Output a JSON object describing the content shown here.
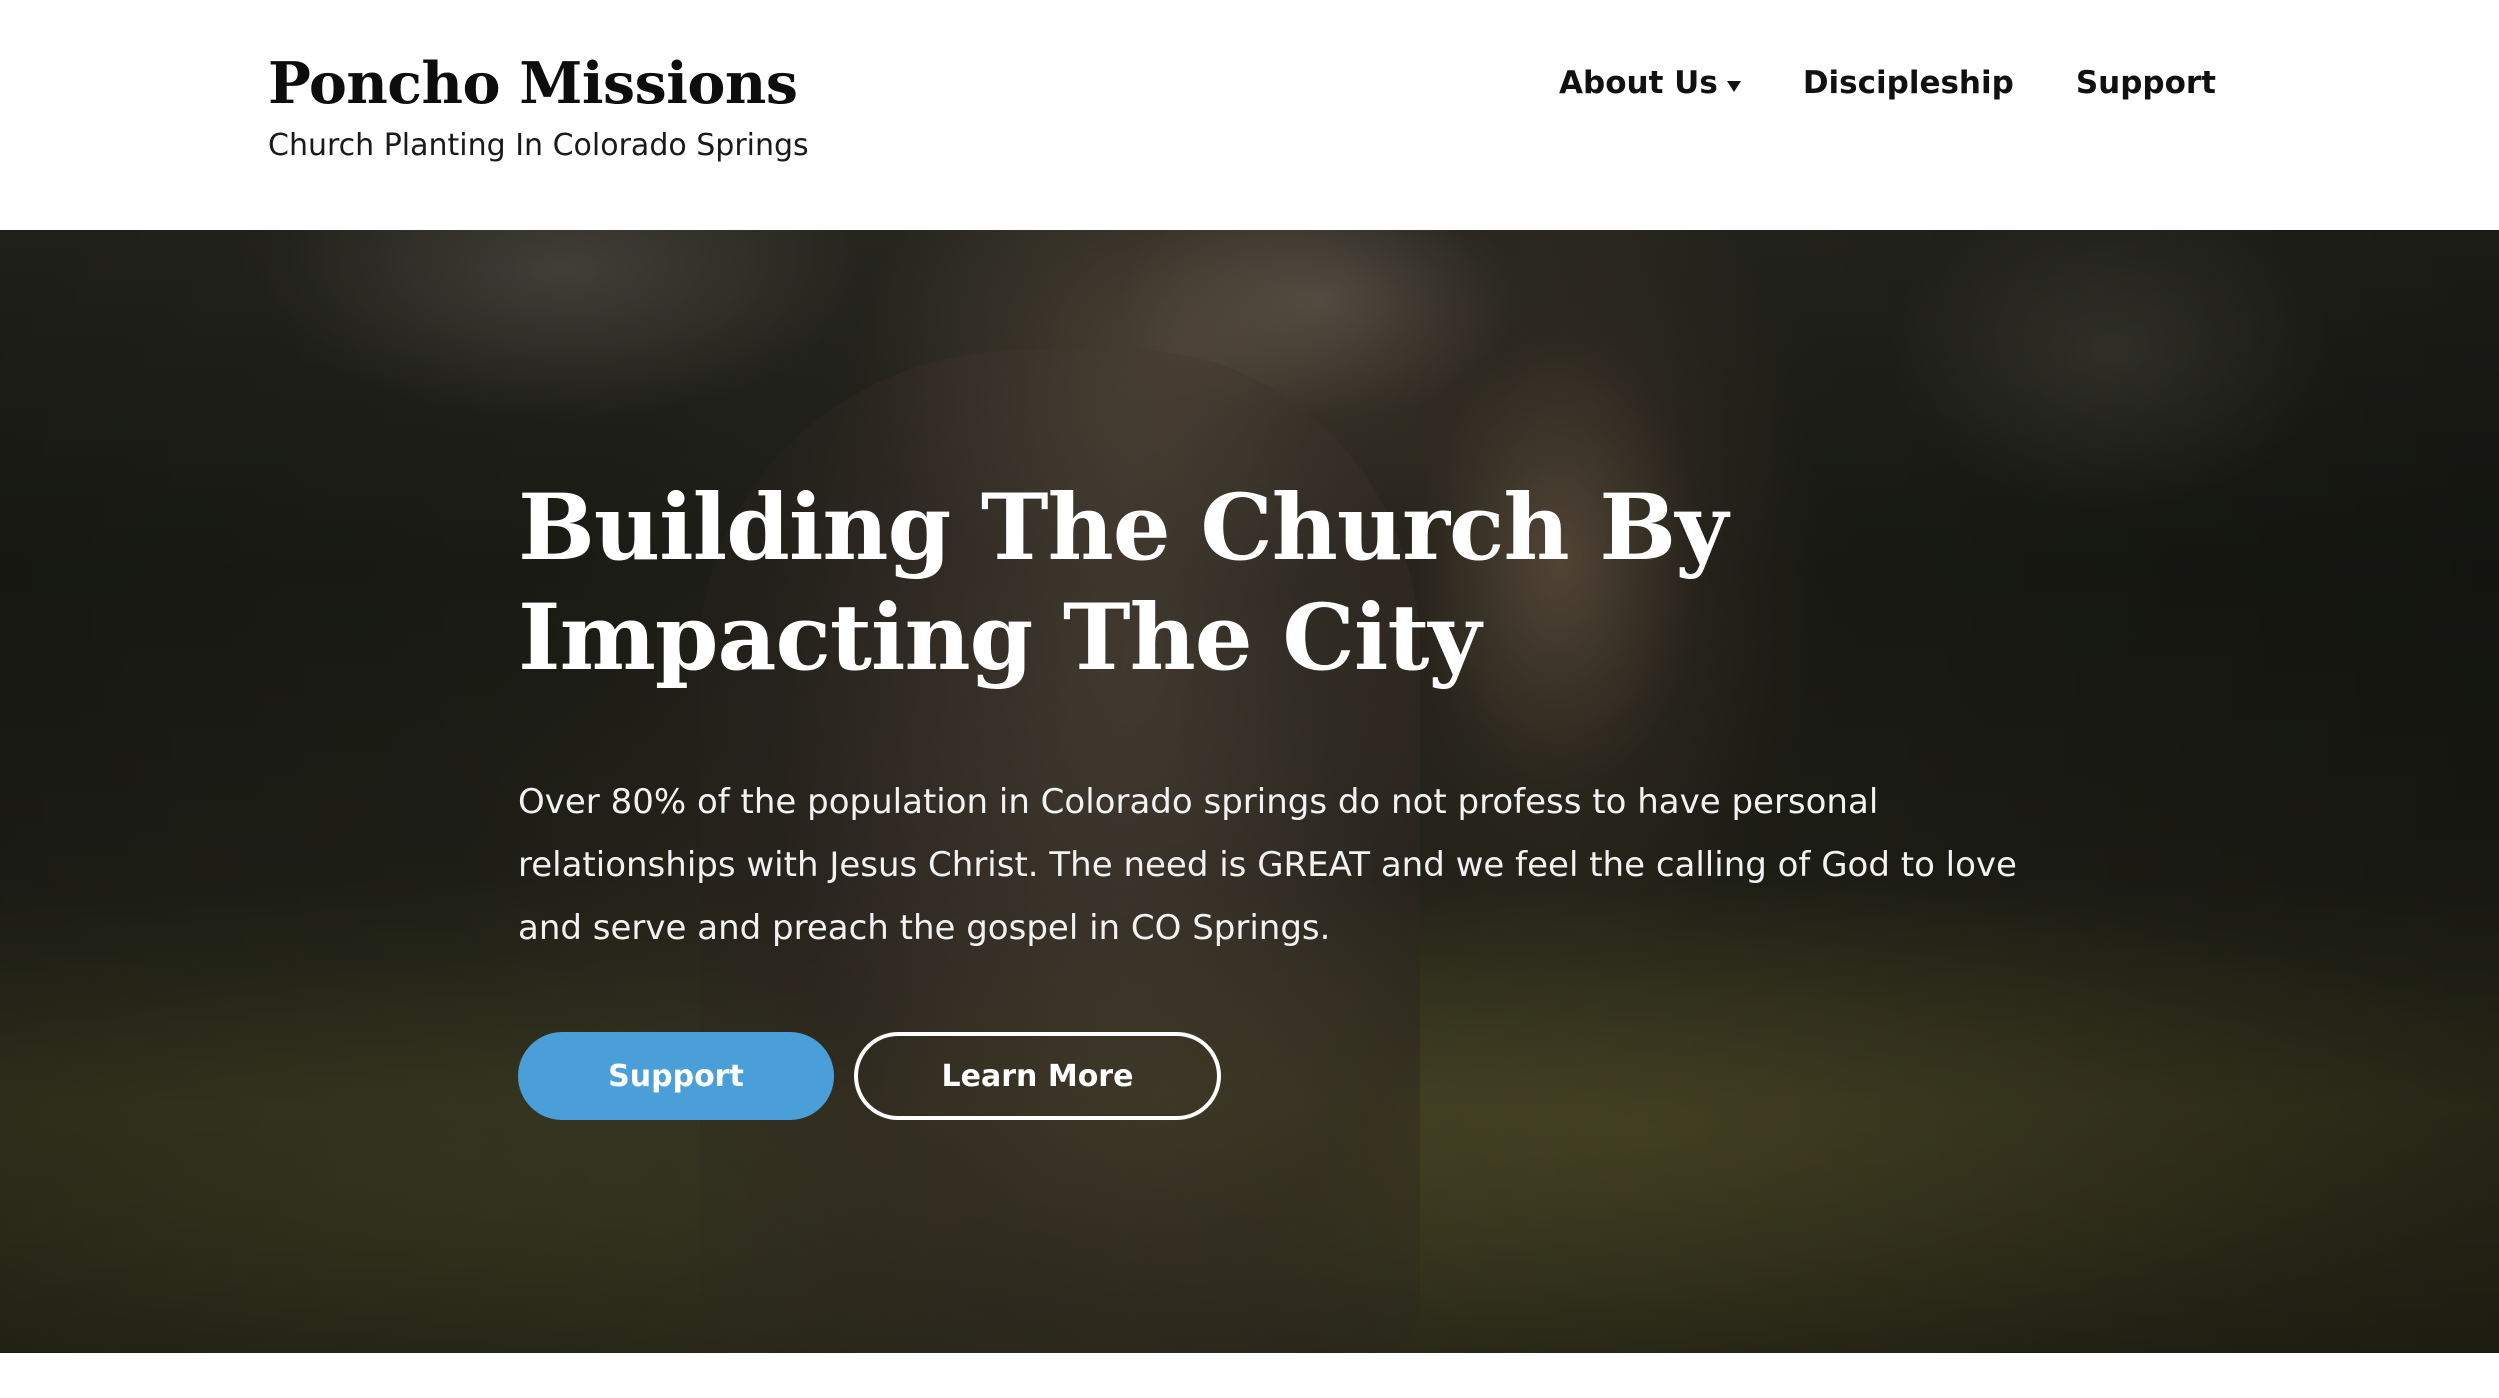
{
  "header": {
    "site_title": "Poncho Missions",
    "site_tagline": "Church Planting In Colorado Springs",
    "nav": [
      {
        "label": "About Us",
        "has_dropdown": true
      },
      {
        "label": "Discipleship",
        "has_dropdown": false
      },
      {
        "label": "Support",
        "has_dropdown": false
      }
    ]
  },
  "hero": {
    "heading": "Building The Church By Impacting The City",
    "text": "Over 80% of the population in Colorado springs do not profess to have personal relationships with Jesus Christ. The need is GREAT and we feel the calling of God to love and serve and preach the gospel in CO Springs.",
    "primary_button": "Support",
    "secondary_button": "Learn More"
  },
  "colors": {
    "primary_button": "#4a9fd8",
    "header_background": "#ffffff",
    "hero_text": "#ffffff"
  },
  "icons": {
    "dropdown": "caret-down-icon"
  }
}
